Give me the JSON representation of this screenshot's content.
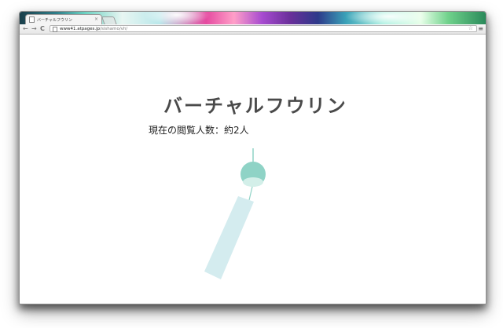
{
  "browser": {
    "tab": {
      "title": "バーチャルフウリン",
      "close_glyph": "×"
    },
    "nav": {
      "back": "←",
      "forward": "→",
      "reload": "C"
    },
    "url": {
      "host": "www41.atpages.jp",
      "path": "/sishamo/vh/"
    },
    "icons": {
      "star": "☆",
      "menu": "≡"
    }
  },
  "page": {
    "title": "バーチャルフウリン",
    "viewers": "現在の閲覧人数：約2人"
  },
  "colors": {
    "furin_bell": "#8fd3c6",
    "furin_bell_rim": "#d3efe9",
    "furin_strip": "#d4ecef",
    "title_text": "#4a4a4a"
  }
}
